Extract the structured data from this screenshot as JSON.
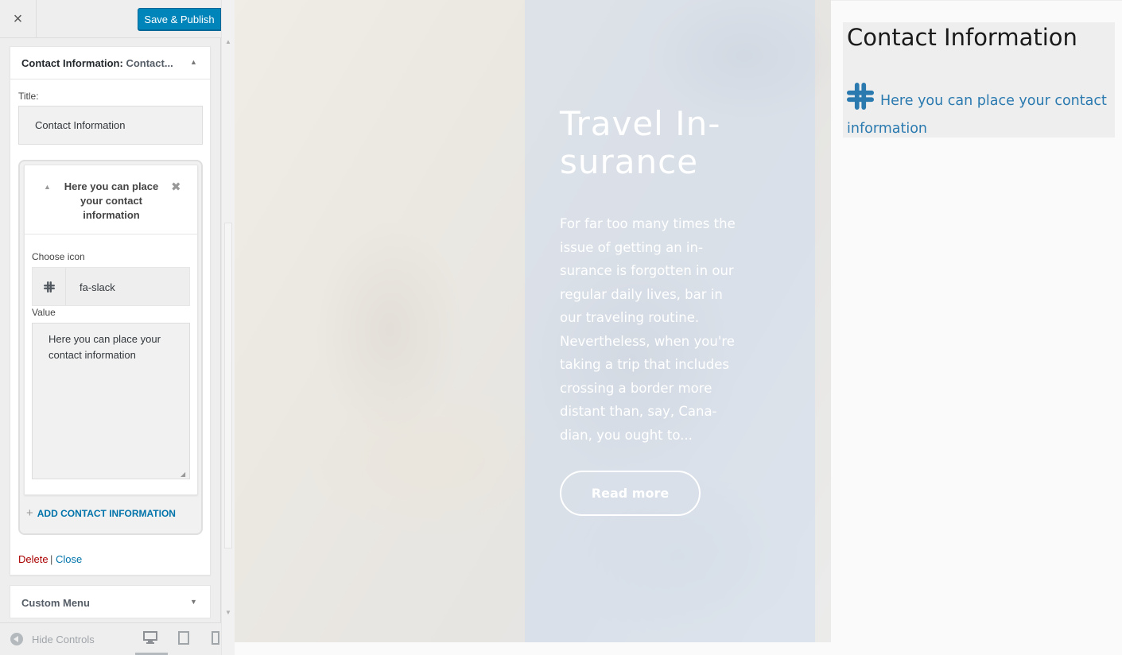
{
  "customizer": {
    "close_symbol": "×",
    "save_label": "Save & Publish"
  },
  "widget": {
    "header_title": "Contact Information:",
    "header_subtitle": "Contact...",
    "title_label": "Title:",
    "title_value": "Contact Information",
    "repeater_item": {
      "header": "Here you can place your contact information",
      "icon_label": "Choose icon",
      "icon_value": "fa-slack",
      "value_label": "Value",
      "value_text": "Here you can place your contact information"
    },
    "add_label": "ADD CONTACT INFORMATION",
    "delete_label": "Delete",
    "separator": "|",
    "close_label": "Close"
  },
  "custom_menu": {
    "label": "Custom Menu"
  },
  "footer": {
    "hide_controls": "Hide Controls"
  },
  "preview": {
    "hero": {
      "title": "Travel In-surance",
      "text": "For far too many times the issue of getting an in-surance is forgotten in our regular daily lives, bar in our traveling routine. Nevertheless, when you're taking a trip that includes crossing a border more distant than, say, Cana-dian, you ought to...",
      "button": "Read more"
    },
    "contact_widget": {
      "title": "Contact Information",
      "line": "Here you can place your contact information",
      "icon": "slack-icon"
    }
  },
  "colors": {
    "accent": "#0085ba",
    "link": "#0073aa",
    "delete": "#aa0000",
    "preview_link": "#2a7ab0"
  }
}
